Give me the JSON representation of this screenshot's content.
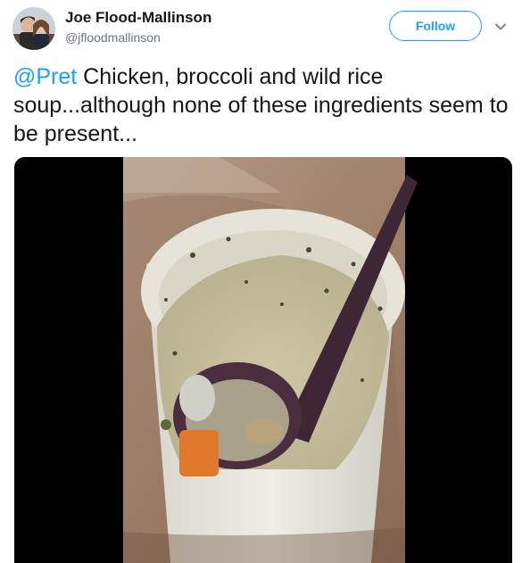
{
  "user": {
    "display_name": "Joe Flood-Mallinson",
    "handle": "@jfloodmallinson"
  },
  "actions": {
    "follow_label": "Follow"
  },
  "tweet": {
    "mention": "@Pret",
    "text": " Chicken, broccoli and wild rice soup...although none of these ingredients seem to be present..."
  },
  "icons": {
    "caret": "chevron-down-icon",
    "media": "video-thumbnail"
  },
  "colors": {
    "accent": "#1da1f2",
    "text": "#14171a",
    "secondary_text": "#657786"
  }
}
